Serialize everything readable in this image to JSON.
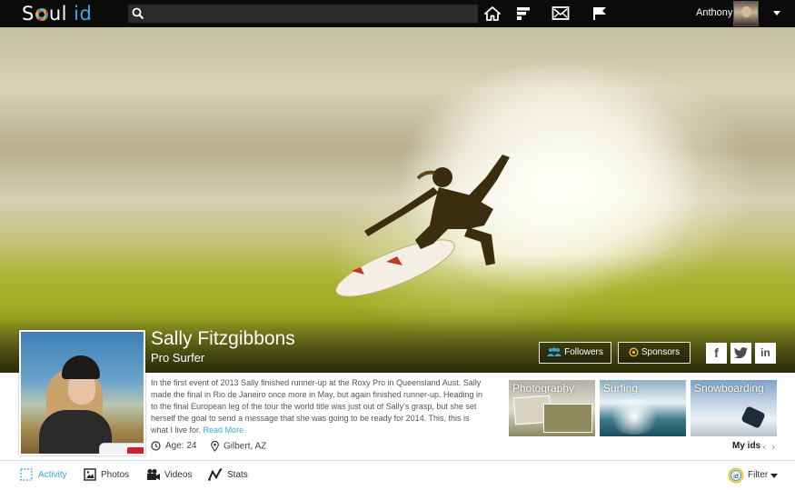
{
  "app": {
    "logo_text": "Soul",
    "logo_accent": "id",
    "accent_color": "#36a9dc"
  },
  "search": {
    "value": "",
    "placeholder": ""
  },
  "nav_icons": [
    "home-icon",
    "feed-icon",
    "mail-icon",
    "flag-icon"
  ],
  "user": {
    "name": "Anthony"
  },
  "profile": {
    "name": "Sally Fitzgibbons",
    "role": "Pro Surfer",
    "bio": "In the first event of 2013 Sally finished runner-up at the Roxy Pro in Queensland Aust. Sally made the final in Rio de Janeiro once more in May, but again finished runner-up. Heading in to the final European leg of the tour the world title was just out of Sally's grasp, but she set herself the goal to send a message that she was going to be ready for 2014. This, this is what I live for.",
    "read_more": "Read More",
    "age": "Age: 24",
    "location": "Gilbert, AZ"
  },
  "hero_buttons": {
    "followers": "Followers",
    "sponsors": "Sponsors"
  },
  "social": {
    "facebook": "f",
    "twitter": "t",
    "linkedin": "in"
  },
  "ids": {
    "items": [
      {
        "label": "Photography"
      },
      {
        "label": "Surfing"
      },
      {
        "label": "Snowboarding"
      }
    ],
    "my_ids_label": "My ids",
    "prev": "‹",
    "next": "›"
  },
  "tabs": [
    {
      "label": "Activity",
      "active": true
    },
    {
      "label": "Photos"
    },
    {
      "label": "Videos"
    },
    {
      "label": "Stats"
    }
  ],
  "filter": {
    "label": "Filter"
  }
}
